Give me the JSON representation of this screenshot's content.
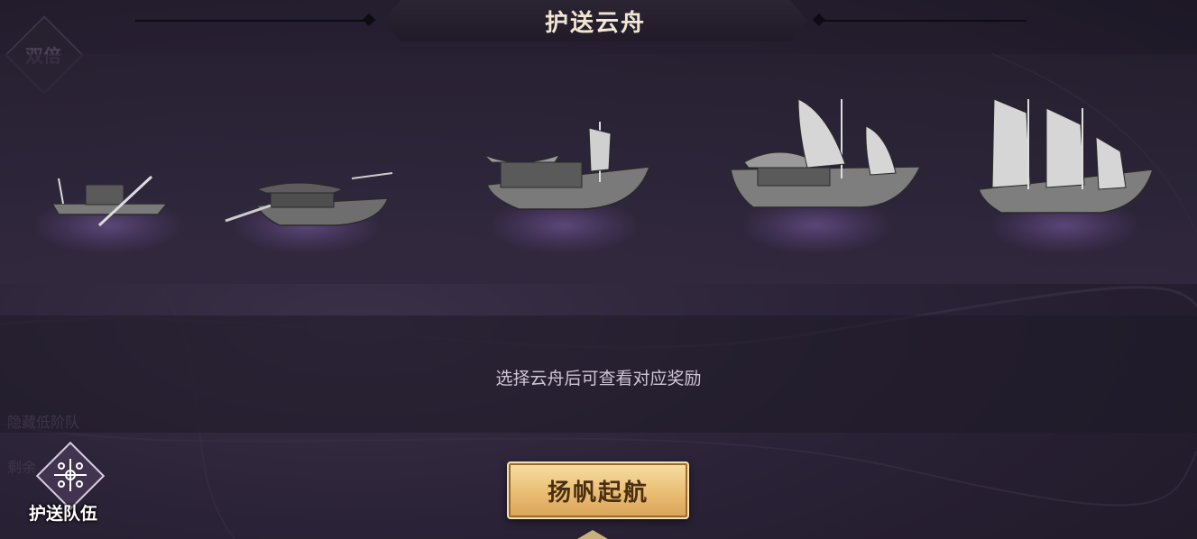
{
  "title": "护送云舟",
  "double_badge": "双倍",
  "boats": [
    {
      "name": "boat-1"
    },
    {
      "name": "boat-2"
    },
    {
      "name": "boat-3"
    },
    {
      "name": "boat-4"
    },
    {
      "name": "boat-5"
    }
  ],
  "hint": "选择云舟后可查看对应奖励",
  "side_labels": [
    "隐藏低阶队",
    "剩余"
  ],
  "sail_button": "扬帆起航",
  "team_button": {
    "label": "护送队伍",
    "icon": "team-icon"
  },
  "colors": {
    "accent": "#e9bd72",
    "text_light": "#f0e6d2"
  }
}
